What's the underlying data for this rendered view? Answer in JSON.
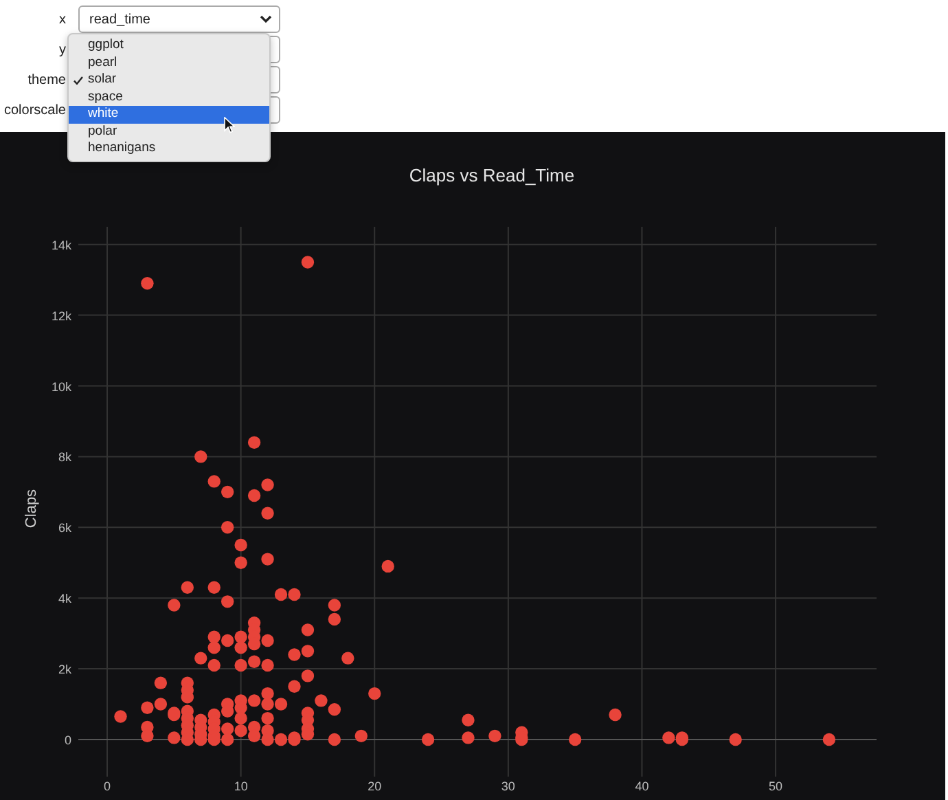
{
  "controls": [
    {
      "label": "x",
      "value": "read_time"
    },
    {
      "label": "y"
    },
    {
      "label": "theme"
    },
    {
      "label": "colorscale"
    }
  ],
  "dropdown": {
    "options": [
      {
        "label": "ggplot",
        "checked": false,
        "highlighted": false
      },
      {
        "label": "pearl",
        "checked": false,
        "highlighted": false
      },
      {
        "label": "solar",
        "checked": true,
        "highlighted": false
      },
      {
        "label": "space",
        "checked": false,
        "highlighted": false
      },
      {
        "label": "white",
        "checked": false,
        "highlighted": true
      },
      {
        "label": "polar",
        "checked": false,
        "highlighted": false
      },
      {
        "label": "henanigans",
        "checked": false,
        "highlighted": false
      }
    ]
  },
  "chart": {
    "chart_data": {
      "type": "scatter",
      "title": "Claps vs Read_Time",
      "ylabel": "Claps",
      "xlim": [
        -2.16,
        57.55
      ],
      "ylim": [
        -1050,
        14500
      ],
      "xticks": [
        0,
        10,
        20,
        30,
        40,
        50
      ],
      "yticks": [
        {
          "value": 0,
          "label": "0"
        },
        {
          "value": 2000,
          "label": "2k"
        },
        {
          "value": 4000,
          "label": "4k"
        },
        {
          "value": 6000,
          "label": "6k"
        },
        {
          "value": 8000,
          "label": "8k"
        },
        {
          "value": 10000,
          "label": "10k"
        },
        {
          "value": 12000,
          "label": "12k"
        },
        {
          "value": 14000,
          "label": "14k"
        }
      ],
      "x": [
        1,
        3,
        15,
        3,
        3,
        3,
        4,
        4,
        5,
        5,
        5,
        5,
        6,
        6,
        6,
        6,
        6,
        6,
        6,
        6,
        6,
        7,
        7,
        7,
        7,
        7,
        7,
        8,
        8,
        8,
        8,
        8,
        8,
        8,
        8,
        8,
        8,
        9,
        9,
        9,
        9,
        9,
        9,
        9,
        9,
        10,
        10,
        10,
        10,
        10,
        10,
        10,
        10,
        10,
        11,
        11,
        11,
        11,
        11,
        11,
        11,
        11,
        11,
        11,
        12,
        12,
        12,
        12,
        12,
        12,
        12,
        12,
        12,
        12,
        13,
        13,
        13,
        14,
        14,
        14,
        14,
        14,
        15,
        15,
        15,
        15,
        15,
        15,
        15,
        16,
        17,
        17,
        17,
        17,
        18,
        19,
        20,
        21,
        24,
        27,
        27,
        29,
        31,
        31,
        31,
        35,
        38,
        42,
        43,
        43,
        47,
        54
      ],
      "grid": true,
      "series": [
        {
          "color": "#e8443a",
          "values": [
            650,
            12900,
            13500,
            900,
            350,
            100,
            1000,
            1600,
            750,
            700,
            50,
            3800,
            4300,
            1600,
            1400,
            1200,
            800,
            600,
            400,
            200,
            0,
            8000,
            2300,
            550,
            350,
            150,
            0,
            7300,
            4300,
            2900,
            2600,
            2100,
            700,
            500,
            300,
            100,
            0,
            7000,
            6000,
            3900,
            2800,
            1000,
            800,
            300,
            0,
            5500,
            5000,
            2900,
            2600,
            2100,
            1100,
            900,
            600,
            250,
            8400,
            6900,
            3300,
            3100,
            2900,
            2700,
            2200,
            1100,
            350,
            100,
            7200,
            6400,
            5100,
            2800,
            2100,
            1300,
            1000,
            600,
            250,
            0,
            4100,
            1000,
            0,
            4100,
            2400,
            1500,
            50,
            0,
            3100,
            2500,
            1800,
            750,
            550,
            300,
            150,
            1100,
            3800,
            3400,
            850,
            0,
            2300,
            100,
            1300,
            4900,
            0,
            550,
            50,
            100,
            200,
            50,
            0,
            0,
            700,
            50,
            50,
            0,
            0,
            0
          ]
        }
      ]
    }
  }
}
